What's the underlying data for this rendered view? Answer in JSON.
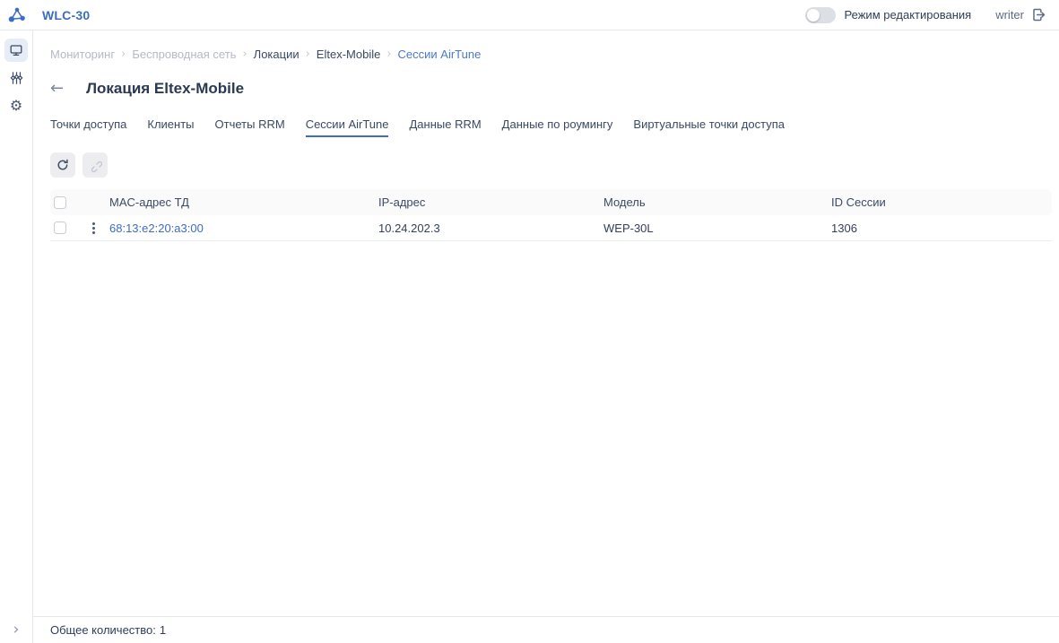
{
  "header": {
    "app_title": "WLC-30",
    "edit_mode": {
      "label": "Режим редактирования",
      "enabled": false
    },
    "username": "writer"
  },
  "icons": {
    "back_glyph": "←",
    "gear_glyph": "⚙",
    "crumb_sep_glyph": "›",
    "expand_glyph": "›"
  },
  "breadcrumb": {
    "items": [
      {
        "label": "Мониторинг"
      },
      {
        "label": "Беспроводная сеть"
      },
      {
        "label": "Локации"
      },
      {
        "label": "Eltex-Mobile"
      },
      {
        "label": "Сессии AirTune"
      }
    ]
  },
  "page": {
    "title": "Локация Eltex-Mobile"
  },
  "tabs": [
    {
      "label": "Точки доступа",
      "active": false
    },
    {
      "label": "Клиенты",
      "active": false
    },
    {
      "label": "Отчеты RRM",
      "active": false
    },
    {
      "label": "Сессии AirTune",
      "active": true
    },
    {
      "label": "Данные RRM",
      "active": false
    },
    {
      "label": "Данные по роумингу",
      "active": false
    },
    {
      "label": "Виртуальные точки доступа",
      "active": false
    }
  ],
  "table": {
    "columns": [
      "MAC-адрес ТД",
      "IP-адрес",
      "Модель",
      "ID Сессии"
    ],
    "rows": [
      {
        "mac": "68:13:e2:20:a3:00",
        "ip": "10.24.202.3",
        "model": "WEP-30L",
        "session_id": "1306"
      }
    ]
  },
  "footer": {
    "total_label": "Общее количество:",
    "total_value": "1"
  },
  "colors": {
    "accent": "#3c6cc3",
    "text_dark": "#33405a",
    "text_muted": "#b3bac6",
    "border": "#e4e7eb",
    "header_bg": "#fafafa"
  }
}
